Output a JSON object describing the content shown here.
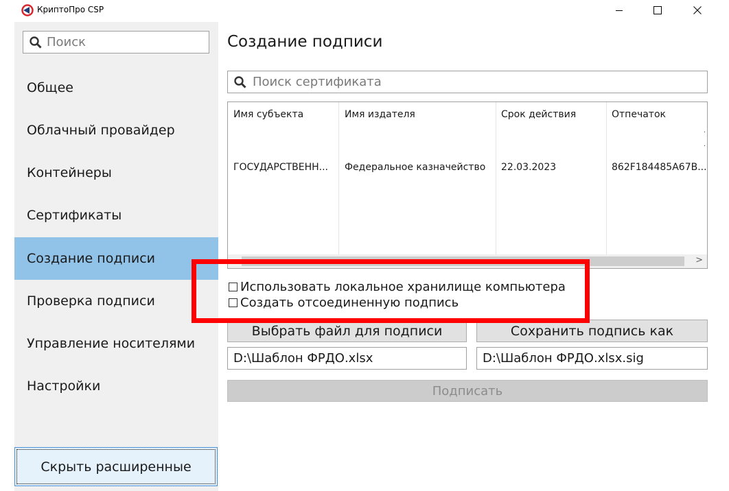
{
  "window": {
    "title": "КриптоПро CSP"
  },
  "sidebar": {
    "search_placeholder": "Поиск",
    "items": [
      {
        "label": "Общее"
      },
      {
        "label": "Облачный провайдер"
      },
      {
        "label": "Контейнеры"
      },
      {
        "label": "Сертификаты"
      },
      {
        "label": "Создание подписи",
        "active": true
      },
      {
        "label": "Проверка подписи"
      },
      {
        "label": "Управление носителями"
      },
      {
        "label": "Настройки"
      }
    ],
    "hide_button": "Скрыть расширенные"
  },
  "main": {
    "title": "Создание подписи",
    "cert_search_placeholder": "Поиск сертификата",
    "table": {
      "columns": [
        "Имя субъекта",
        "Имя издателя",
        "Срок действия",
        "Отпечаток"
      ],
      "rows": [
        [
          "ГОСУДАРСТВЕНН...",
          "Федеральное казначейство",
          "22.03.2023",
          "862F184485A67B..."
        ]
      ]
    },
    "options": {
      "local_store": "Использовать локальное хранилище компьютера",
      "detached": "Создать отсоединенную подпись"
    },
    "select_file_button": "Выбрать файл для подписи",
    "save_as_button": "Сохранить подпись как",
    "input_file": "D:\\Шаблон ФРДО.xlsx",
    "output_file": "D:\\Шаблон ФРДО.xlsx.sig",
    "sign_button": "Подписать"
  },
  "colors": {
    "active_item": "#91c2e8",
    "highlight_box": "#ff0000",
    "sidebar_bg": "#f0f0f0"
  }
}
